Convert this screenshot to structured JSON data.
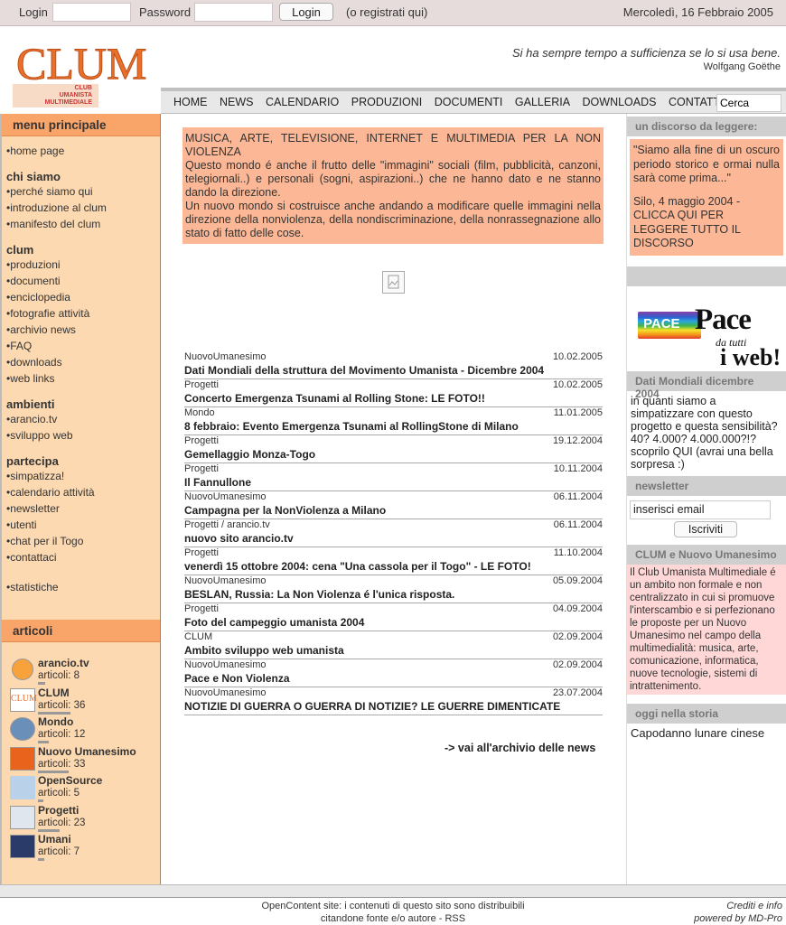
{
  "topbar": {
    "login_label": "Login",
    "password_label": "Password",
    "login_button": "Login",
    "register_text": "(o registrati qui)",
    "date": "Mercoledì, 16 Febbraio 2005"
  },
  "header": {
    "quote": "Si ha sempre tempo a sufficienza se lo si usa bene.",
    "author": "Wolfgang Goëthe",
    "logo_text": "CLUM",
    "logo_sub": [
      "CLUB",
      "UMANISTA",
      "MULTIMEDIALE"
    ]
  },
  "nav": {
    "items": [
      "HOME",
      "NEWS",
      "CALENDARIO",
      "PRODUZIONI",
      "DOCUMENTI",
      "GALLERIA",
      "DOWNLOADS",
      "CONTATTO"
    ],
    "search_value": "Cerca"
  },
  "left": {
    "menu_title": "menu principale",
    "home": "home page",
    "sections": [
      {
        "title": "chi siamo",
        "items": [
          "perché siamo qui",
          "introduzione al clum",
          "manifesto del clum"
        ]
      },
      {
        "title": "clum",
        "items": [
          "produzioni",
          "documenti",
          "enciclopedia",
          "fotografie attività",
          "archivio news",
          "FAQ",
          "downloads",
          "web links"
        ]
      },
      {
        "title": "ambienti",
        "items": [
          "arancio.tv",
          "sviluppo web"
        ]
      },
      {
        "title": "partecipa",
        "items": [
          "simpatizza!",
          "calendario attività",
          "newsletter",
          "utenti",
          "chat per il Togo",
          "contattaci"
        ]
      }
    ],
    "extra": "statistiche",
    "articles_title": "articoli",
    "articles": [
      {
        "name": "arancio.tv",
        "count": "articoli: 8",
        "level": 0.2
      },
      {
        "name": "CLUM",
        "count": "articoli: 36",
        "level": 0.9
      },
      {
        "name": "Mondo",
        "count": "articoli: 12",
        "level": 0.3
      },
      {
        "name": "Nuovo Umanesimo",
        "count": "articoli: 33",
        "level": 0.85
      },
      {
        "name": "OpenSource",
        "count": "articoli: 5",
        "level": 0.12
      },
      {
        "name": "Progetti",
        "count": "articoli: 23",
        "level": 0.6
      },
      {
        "name": "Umani",
        "count": "articoli: 7",
        "level": 0.18
      }
    ]
  },
  "intro": {
    "title": "MUSICA, ARTE, TELEVISIONE, INTERNET E MULTIMEDIA PER LA NON VIOLENZA",
    "p1": "Questo mondo é anche il frutto delle \"immagini\" sociali (film, pubblicità, canzoni, telegiornali..) e personali (sogni, aspirazioni..) che ne hanno dato e ne stanno dando la direzione.",
    "p2": "Un nuovo mondo si costruisce anche andando a modificare quelle immagini nella direzione della nonviolenza, della nondiscriminazione, della nonrassegnazione allo stato di fatto delle cose."
  },
  "news": [
    {
      "cat": "NuovoUmanesimo",
      "date": "10.02.2005",
      "title": "Dati Mondiali della struttura del Movimento Umanista - Dicembre 2004"
    },
    {
      "cat": "Progetti",
      "date": "10.02.2005",
      "title": "Concerto Emergenza Tsunami al Rolling Stone: LE FOTO!!"
    },
    {
      "cat": "Mondo",
      "date": "11.01.2005",
      "title": "8 febbraio: Evento Emergenza Tsunami al RollingStone di Milano"
    },
    {
      "cat": "Progetti",
      "date": "19.12.2004",
      "title": "Gemellaggio Monza-Togo"
    },
    {
      "cat": "Progetti",
      "date": "10.11.2004",
      "title": "Il Fannullone"
    },
    {
      "cat": "NuovoUmanesimo",
      "date": "06.11.2004",
      "title": "Campagna per la NonViolenza a Milano"
    },
    {
      "cat": "Progetti / arancio.tv",
      "date": "06.11.2004",
      "title": "nuovo sito arancio.tv"
    },
    {
      "cat": "Progetti",
      "date": "11.10.2004",
      "title": "venerdì 15 ottobre 2004: cena \"Una cassola per il Togo\" - LE FOTO!"
    },
    {
      "cat": "NuovoUmanesimo",
      "date": "05.09.2004",
      "title": "BESLAN, Russia: La Non Violenza é l'unica risposta."
    },
    {
      "cat": "Progetti",
      "date": "04.09.2004",
      "title": "Foto del campeggio umanista 2004"
    },
    {
      "cat": "CLUM",
      "date": "02.09.2004",
      "title": "Ambito sviluppo web umanista"
    },
    {
      "cat": "NuovoUmanesimo",
      "date": "02.09.2004",
      "title": "Pace e Non Violenza"
    },
    {
      "cat": "NuovoUmanesimo",
      "date": "23.07.2004",
      "title": "NOTIZIE DI GUERRA O GUERRA DI NOTIZIE? LE GUERRE DIMENTICATE"
    }
  ],
  "archive_link": "-> vai all'archivio delle news",
  "right": {
    "speech_title": "un discorso da leggere:",
    "speech_quote": "\"Siamo alla fine di un oscuro periodo storico e ormai nulla sarà come prima...\"",
    "speech_source": "Silo, 4 maggio 2004 - CLICCA QUI PER LEGGERE TUTTO IL DISCORSO",
    "pace_flag": "PACE",
    "pace_big": "Pace",
    "pace_small": "da tutti",
    "pace_web": "i web!",
    "dati_title": "Dati Mondiali dicembre 2004",
    "dati_text": "in quanti siamo a simpatizzare con questo progetto e questa sensibilità? 40? 4.000? 4.000.000?!? scoprilo QUI (avrai una bella sorpresa :)",
    "newsletter_title": "newsletter",
    "newsletter_input": "inserisci email",
    "newsletter_button": "Iscriviti",
    "clum_title": "CLUM e Nuovo Umanesimo",
    "clum_text": "Il Club Umanista Multimediale é un ambito non formale e non centralizzato in cui si promuove l'interscambio e si perfezionano le proposte per un Nuovo Umanesimo nel campo della multimedialità: musica, arte, comunicazione, informatica, nuove tecnologie, sistemi di intrattenimento.",
    "history_title": "oggi nella storia",
    "history_text": "Capodanno lunare cinese"
  },
  "footer": {
    "center_line1": "OpenContent site: i contenuti di questo sito sono distribuibili",
    "center_line2": "citandone fonte e/o autore - RSS",
    "right_line1": "Crediti e info",
    "right_line2": "powered by MD-Pro"
  },
  "colors": {
    "sidebar_bg": "#fdd9b1",
    "sidebar_head": "#f9a56a",
    "intro_bg": "#fcb896",
    "clum_box": "#ffd7d7"
  }
}
